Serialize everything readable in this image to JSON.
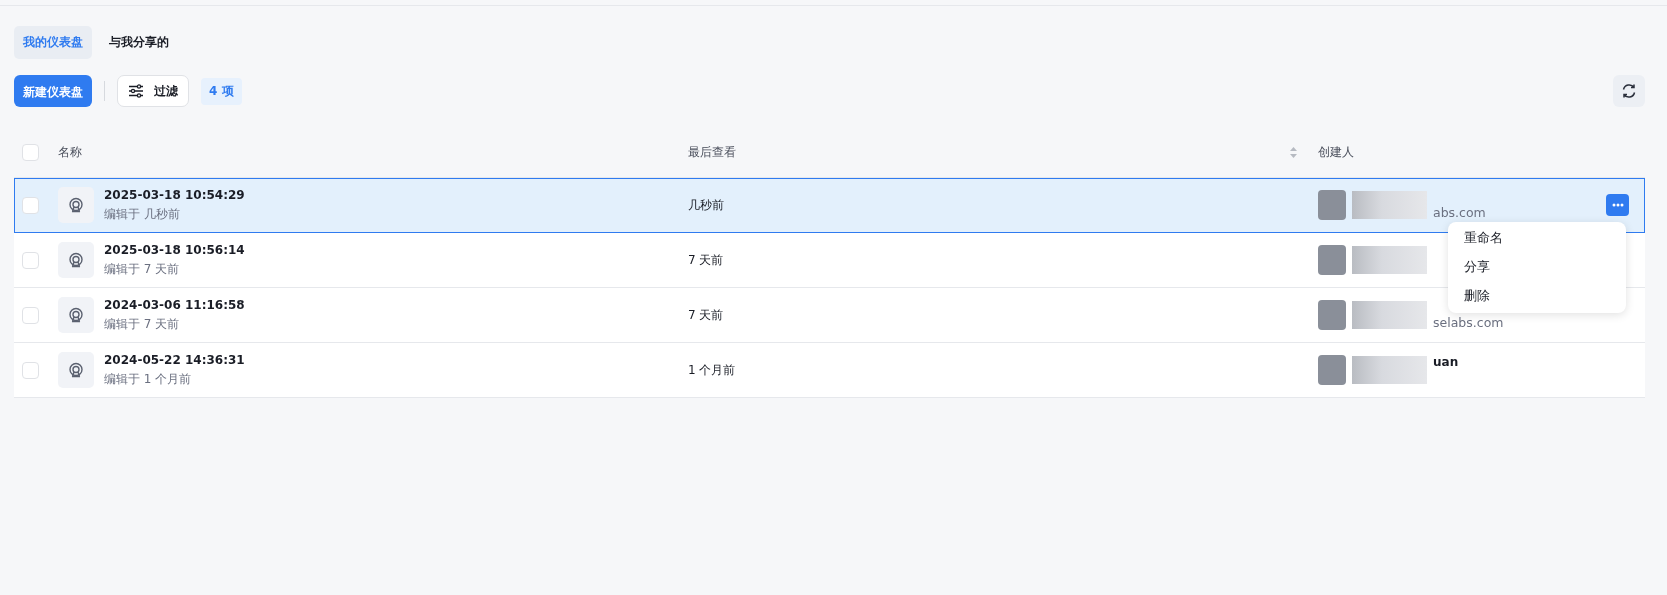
{
  "tabs": [
    {
      "label": "我的仪表盘",
      "selected": true
    },
    {
      "label": "与我分享的",
      "selected": false
    }
  ],
  "toolbar": {
    "new_button": "新建仪表盘",
    "filter_button": "过滤",
    "count": "4 项"
  },
  "table": {
    "select_all_checked": false,
    "columns": [
      "名称",
      "最后查看",
      "创建人"
    ],
    "rows": [
      {
        "title": "2025-03-18 10:54:29",
        "edited": "编辑于 几秒前",
        "last_viewed": "几秒前",
        "creator_email": "abs.com",
        "selected": true,
        "checked": false
      },
      {
        "title": "2025-03-18 10:56:14",
        "edited": "编辑于 7 天前",
        "last_viewed": "7 天前",
        "selected": false,
        "checked": false
      },
      {
        "title": "2024-03-06 11:16:58",
        "edited": "编辑于 7 天前",
        "last_viewed": "7 天前",
        "creator_email": "selabs.com",
        "selected": false,
        "checked": false
      },
      {
        "title": "2024-05-22 14:36:31",
        "edited": "编辑于 1 个月前",
        "last_viewed": "1 个月前",
        "creator_name": "uan",
        "selected": false,
        "checked": false
      }
    ],
    "row_menu": [
      "重命名",
      "分享",
      "删除"
    ]
  }
}
